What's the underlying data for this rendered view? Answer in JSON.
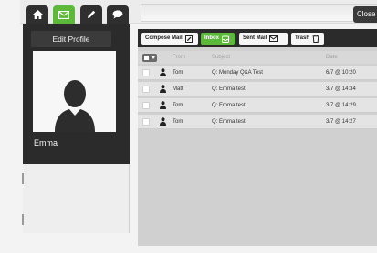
{
  "nav": {
    "home_icon": "home-icon",
    "mail_icon": "mail-icon",
    "edit_icon": "pencil-icon",
    "chat_icon": "chat-icon",
    "close_label": "Close",
    "accent_color": "#5cb93a"
  },
  "profile": {
    "edit_label": "Edit Profile",
    "username": "Emma"
  },
  "mail": {
    "tabs": {
      "compose": "Compose Mail",
      "inbox": "Inbox",
      "sent": "Sent Mail",
      "trash": "Trash"
    },
    "columns": {
      "from": "From",
      "subject": "Subject",
      "date": "Date"
    },
    "rows": [
      {
        "from": "Tom",
        "subject": "Q: Monday Q&A Test",
        "date": "6/7 @ 10:20"
      },
      {
        "from": "Matt",
        "subject": "Q: Emma test",
        "date": "3/7 @ 14:34"
      },
      {
        "from": "Tom",
        "subject": "Q: Emma test",
        "date": "3/7 @ 14:29"
      },
      {
        "from": "Tom",
        "subject": "Q: Emma test",
        "date": "3/7 @ 14:27"
      }
    ]
  }
}
